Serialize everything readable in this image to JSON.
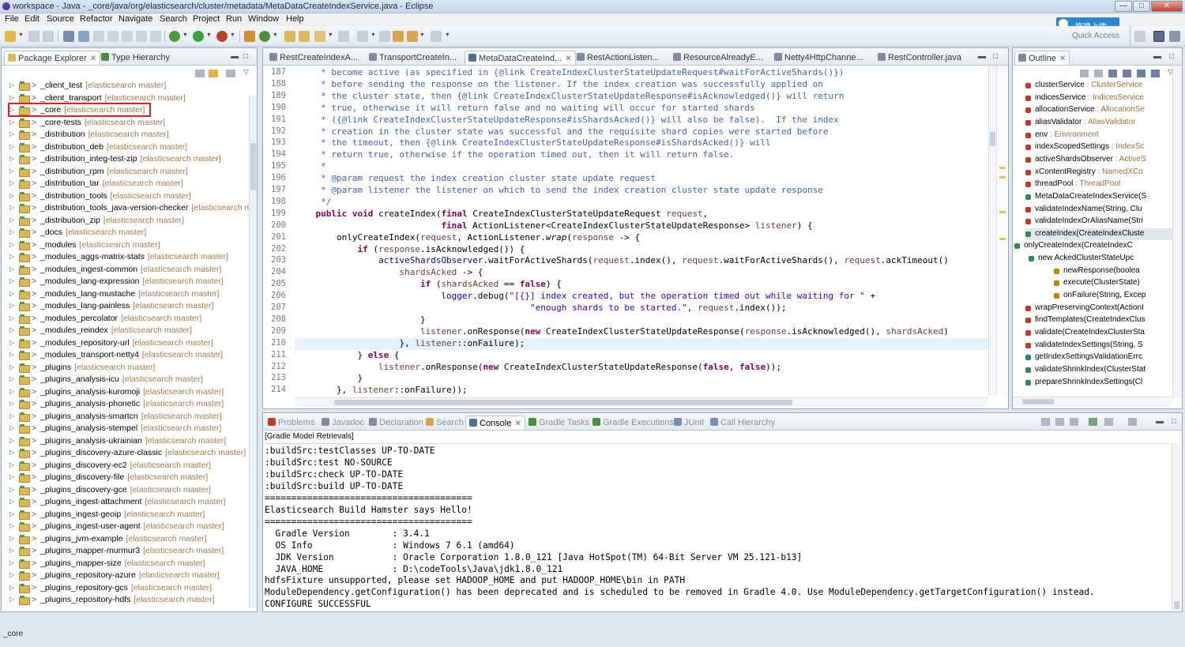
{
  "window": {
    "title": "workspace - Java - _core/java/org/elasticsearch/cluster/metadata/MetaDataCreateIndexService.java - Eclipse",
    "min": "—",
    "max": "□",
    "close": "✕"
  },
  "menu": [
    "File",
    "Edit",
    "Source",
    "Refactor",
    "Navigate",
    "Search",
    "Project",
    "Run",
    "Window",
    "Help"
  ],
  "cloud_button": "拖拽上传",
  "quick_access": "Quick Access",
  "package_explorer": {
    "tabs": [
      "Package Explorer",
      "Type Hierarchy"
    ],
    "items": [
      {
        "name": "_client_test",
        "repo": "[elasticsearch master]"
      },
      {
        "name": "_client_transport",
        "repo": "[elasticsearch master]"
      },
      {
        "name": "_core",
        "repo": "[elasticsearch master]"
      },
      {
        "name": "_core-tests",
        "repo": "[elasticsearch master]"
      },
      {
        "name": "_distribution",
        "repo": "[elasticsearch master]"
      },
      {
        "name": "_distribution_deb",
        "repo": "[elasticsearch master]"
      },
      {
        "name": "_distribution_integ-test-zip",
        "repo": "[elasticsearch master]"
      },
      {
        "name": "_distribution_rpm",
        "repo": "[elasticsearch master]"
      },
      {
        "name": "_distribution_tar",
        "repo": "[elasticsearch master]"
      },
      {
        "name": "_distribution_tools",
        "repo": "[elasticsearch master]"
      },
      {
        "name": "_distribution_tools_java-version-checker",
        "repo": "[elasticsearch mas"
      },
      {
        "name": "_distribution_zip",
        "repo": "[elasticsearch master]"
      },
      {
        "name": "_docs",
        "repo": "[elasticsearch master]"
      },
      {
        "name": "_modules",
        "repo": "[elasticsearch master]"
      },
      {
        "name": "_modules_aggs-matrix-stats",
        "repo": "[elasticsearch master]"
      },
      {
        "name": "_modules_ingest-common",
        "repo": "[elasticsearch master]"
      },
      {
        "name": "_modules_lang-expression",
        "repo": "[elasticsearch master]"
      },
      {
        "name": "_modules_lang-mustache",
        "repo": "[elasticsearch master]"
      },
      {
        "name": "_modules_lang-painless",
        "repo": "[elasticsearch master]"
      },
      {
        "name": "_modules_percolator",
        "repo": "[elasticsearch master]"
      },
      {
        "name": "_modules_reindex",
        "repo": "[elasticsearch master]"
      },
      {
        "name": "_modules_repository-url",
        "repo": "[elasticsearch master]"
      },
      {
        "name": "_modules_transport-netty4",
        "repo": "[elasticsearch master]"
      },
      {
        "name": "_plugins",
        "repo": "[elasticsearch master]"
      },
      {
        "name": "_plugins_analysis-icu",
        "repo": "[elasticsearch master]"
      },
      {
        "name": "_plugins_analysis-kuromoji",
        "repo": "[elasticsearch master]"
      },
      {
        "name": "_plugins_analysis-phonetic",
        "repo": "[elasticsearch master]"
      },
      {
        "name": "_plugins_analysis-smartcn",
        "repo": "[elasticsearch master]"
      },
      {
        "name": "_plugins_analysis-stempel",
        "repo": "[elasticsearch master]"
      },
      {
        "name": "_plugins_analysis-ukrainian",
        "repo": "[elasticsearch master]"
      },
      {
        "name": "_plugins_discovery-azure-classic",
        "repo": "[elasticsearch master]"
      },
      {
        "name": "_plugins_discovery-ec2",
        "repo": "[elasticsearch master]"
      },
      {
        "name": "_plugins_discovery-file",
        "repo": "[elasticsearch master]"
      },
      {
        "name": "_plugins_discovery-gce",
        "repo": "[elasticsearch master]"
      },
      {
        "name": "_plugins_ingest-attachment",
        "repo": "[elasticsearch master]"
      },
      {
        "name": "_plugins_ingest-geoip",
        "repo": "[elasticsearch master]"
      },
      {
        "name": "_plugins_ingest-user-agent",
        "repo": "[elasticsearch master]"
      },
      {
        "name": "_plugins_jvm-example",
        "repo": "[elasticsearch master]"
      },
      {
        "name": "_plugins_mapper-murmur3",
        "repo": "[elasticsearch master]"
      },
      {
        "name": "_plugins_mapper-size",
        "repo": "[elasticsearch master]"
      },
      {
        "name": "_plugins_repository-azure",
        "repo": "[elasticsearch master]"
      },
      {
        "name": "_plugins_repository-gcs",
        "repo": "[elasticsearch master]"
      },
      {
        "name": "_plugins_repository-hdfs",
        "repo": "[elasticsearch master]"
      }
    ]
  },
  "editor": {
    "tabs": [
      "RestCreateIndexA...",
      "TransportCreateIn...",
      "MetaDataCreateInd...",
      "RestActionListen...",
      "ResourceAlreadyE...",
      "Netty4HttpChanne...",
      "RestController.java"
    ],
    "active_tab": 2,
    "line_numbers": [
      "187",
      "188",
      "189",
      "190",
      "191",
      "192",
      "193",
      "194",
      "195",
      "196",
      "197",
      "198",
      "199",
      "200",
      "201",
      "202",
      "203",
      "204",
      "205",
      "206",
      "207",
      "208",
      "209",
      "210",
      "211",
      "212",
      "213",
      "214"
    ],
    "lines": [
      "     * become active (as specified in {@link CreateIndexClusterStateUpdateRequest#waitForActiveShards()})",
      "     * before sending the response on the listener. If the index creation was successfully applied on",
      "     * the cluster state, then {@link CreateIndexClusterStateUpdateResponse#isAcknowledged()} will return",
      "     * true, otherwise it will return false and no waiting will occur for started shards",
      "     * ({@link CreateIndexClusterStateUpdateResponse#isShardsAcked()} will also be false).  If the index",
      "     * creation in the cluster state was successful and the requisite shard copies were started before",
      "     * the timeout, then {@link CreateIndexClusterStateUpdateResponse#isShardsAcked()} will",
      "     * return true, otherwise if the operation timed out, then it will return false.",
      "     *",
      "     * @param request the index creation cluster state update request",
      "     * @param listener the listener on which to send the index creation cluster state update response",
      "     */",
      "    public void createIndex(final CreateIndexClusterStateUpdateRequest request,",
      "                            final ActionListener<CreateIndexClusterStateUpdateResponse> listener) {",
      "        onlyCreateIndex(request, ActionListener.wrap(response -> {",
      "            if (response.isAcknowledged()) {",
      "                activeShardsObserver.waitForActiveShards(request.index(), request.waitForActiveShards(), request.ackTimeout()",
      "                    shardsAcked -> {",
      "                        if (shardsAcked == false) {",
      "                            logger.debug(\"[{}] index created, but the operation timed out while waiting for \" +",
      "                                             \"enough shards to be started.\", request.index());",
      "                        }",
      "                        listener.onResponse(new CreateIndexClusterStateUpdateResponse(response.isAcknowledged(), shardsAcked)",
      "                    }, listener::onFailure);",
      "            } else {",
      "                listener.onResponse(new CreateIndexClusterStateUpdateResponse(false, false));",
      "            }",
      "        }, listener::onFailure));"
    ]
  },
  "outline": {
    "tab": "Outline",
    "items": [
      {
        "name": "clusterService",
        "type": " : ClusterService",
        "color": "#c0392b"
      },
      {
        "name": "indicesService",
        "type": " : IndicesService",
        "color": "#c0392b"
      },
      {
        "name": "allocationService",
        "type": " : AllocationSe",
        "color": "#c0392b"
      },
      {
        "name": "aliasValidator",
        "type": " : AliasValidator",
        "color": "#c0392b"
      },
      {
        "name": "env",
        "type": " : Environment",
        "color": "#c0392b"
      },
      {
        "name": "indexScopedSettings",
        "type": " : IndexSc",
        "color": "#c0392b"
      },
      {
        "name": "activeShardsObserver",
        "type": " : ActiveS",
        "color": "#c0392b"
      },
      {
        "name": "xContentRegistry",
        "type": " : NamedXCo",
        "color": "#c0392b"
      },
      {
        "name": "threadPool",
        "type": " : ThreadPool",
        "color": "#c0392b"
      },
      {
        "name": "MetaDataCreateIndexService(S",
        "type": "",
        "color": "#2e8b57"
      },
      {
        "name": "validateIndexName(String, Clu",
        "type": "",
        "color": "#c0392b"
      },
      {
        "name": "validateIndexOrAliasName(Stri",
        "type": "",
        "color": "#c0392b"
      },
      {
        "name": "createIndex(CreateIndexCluste",
        "type": "",
        "color": "#2e8b57"
      },
      {
        "name": "onlyCreateIndex(CreateIndexC",
        "type": "",
        "color": "#2e8b57"
      },
      {
        "name": "new AckedClusterStateUpc",
        "type": "",
        "color": "#2e8b57"
      },
      {
        "name": "newResponse(boolea",
        "type": "",
        "color": "#b8860b"
      },
      {
        "name": "execute(ClusterState)",
        "type": "",
        "color": "#b8860b"
      },
      {
        "name": "onFailure(String, Excep",
        "type": "",
        "color": "#b8860b"
      },
      {
        "name": "wrapPreservingContext(ActionI",
        "type": "",
        "color": "#c0392b"
      },
      {
        "name": "findTemplates(CreateIndexClus",
        "type": "",
        "color": "#c0392b"
      },
      {
        "name": "validate(CreateIndexClusterSta",
        "type": "",
        "color": "#c0392b"
      },
      {
        "name": "validateIndexSettings(String, S",
        "type": "",
        "color": "#c0392b"
      },
      {
        "name": "getIndexSettingsValidationErrc",
        "type": "",
        "color": "#2e8b57"
      },
      {
        "name": "validateShrinkIndex(ClusterStat",
        "type": "",
        "color": "#2e8b57"
      },
      {
        "name": "prepareShrinkIndexSettings(Cl",
        "type": "",
        "color": "#2e8b57"
      }
    ]
  },
  "console": {
    "tabs": [
      "Problems",
      "Javadoc",
      "Declaration",
      "Search",
      "Console",
      "Gradle Tasks",
      "Gradle Executions",
      "JUnit",
      "Call Hierarchy"
    ],
    "active_tab": 4,
    "label": "[Gradle Model Retrievals]",
    "lines": [
      ":buildSrc:testClasses UP-TO-DATE",
      ":buildSrc:test NO-SOURCE",
      ":buildSrc:check UP-TO-DATE",
      ":buildSrc:build UP-TO-DATE",
      "=======================================",
      "Elasticsearch Build Hamster says Hello!",
      "=======================================",
      "  Gradle Version        : 3.4.1",
      "  OS Info               : Windows 7 6.1 (amd64)",
      "  JDK Version           : Oracle Corporation 1.8.0_121 [Java HotSpot(TM) 64-Bit Server VM 25.121-b13]",
      "  JAVA_HOME             : D:\\codeTools\\Java\\jdk1.8.0_121",
      "hdfsFixture unsupported, please set HADOOP_HOME and put HADOOP_HOME\\bin in PATH",
      "ModuleDependency.getConfiguration() has been deprecated and is scheduled to be removed in Gradle 4.0. Use ModuleDependency.getTargetConfiguration() instead.",
      "CONFIGURE SUCCESSFUL"
    ]
  },
  "status": {
    "text": "_core"
  }
}
